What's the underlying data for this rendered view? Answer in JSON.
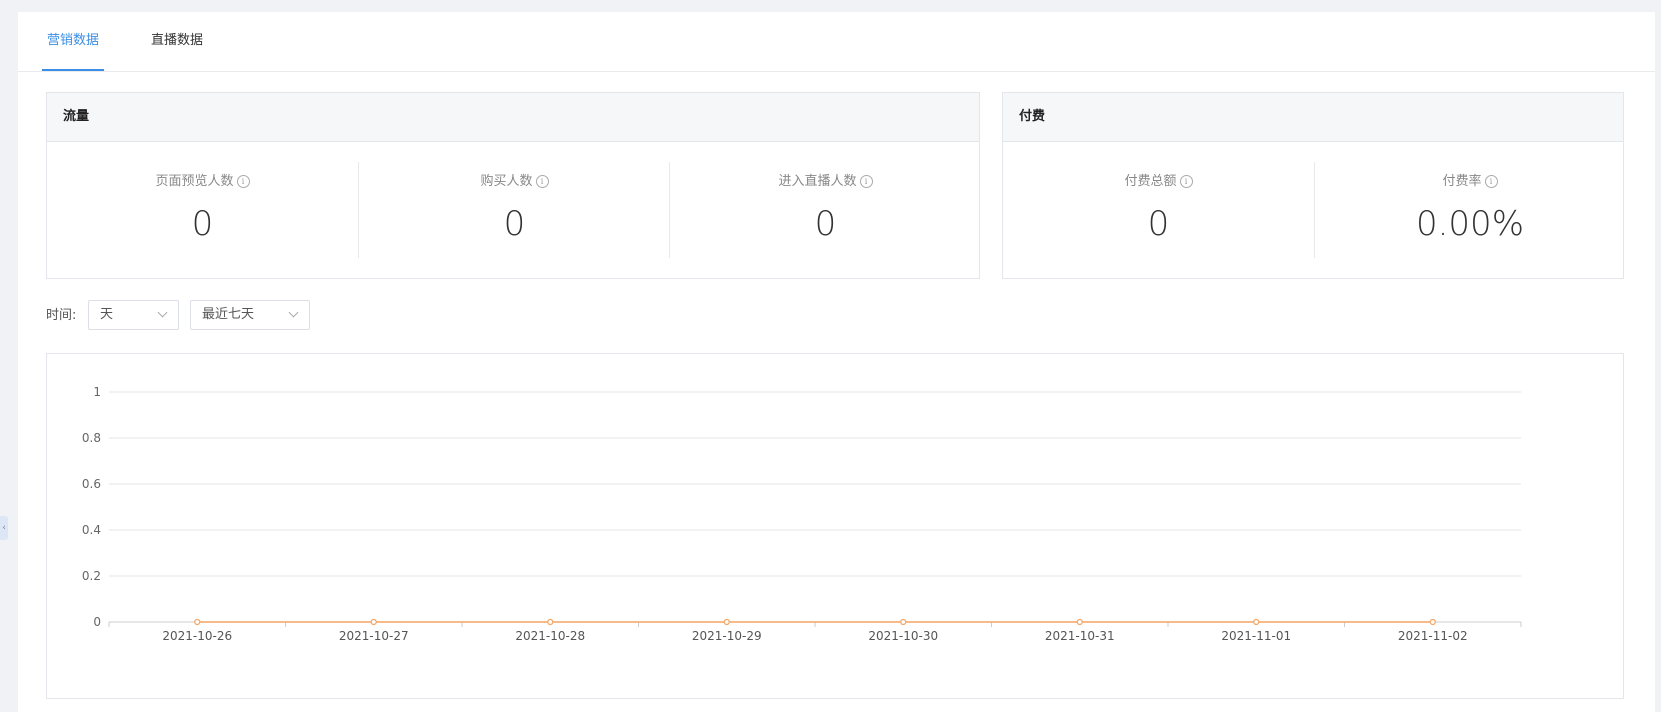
{
  "tabs": [
    {
      "label": "营销数据",
      "active": true
    },
    {
      "label": "直播数据",
      "active": false
    }
  ],
  "traffic_card": {
    "title": "流量",
    "stats": [
      {
        "label": "页面预览人数",
        "value": "0"
      },
      {
        "label": "购买人数",
        "value": "0"
      },
      {
        "label": "进入直播人数",
        "value": "0"
      }
    ]
  },
  "payment_card": {
    "title": "付费",
    "stats": [
      {
        "label": "付费总额",
        "value": "0"
      },
      {
        "label": "付费率",
        "value": "0.00%"
      }
    ]
  },
  "time_filter": {
    "label": "时间:",
    "granularity": "天",
    "range": "最近七天"
  },
  "icons": {
    "info": "info-icon",
    "chevron": "chevron-down-icon",
    "collapse": "chevron-left-icon"
  },
  "colors": {
    "accent": "#3a8ee6",
    "series": "#f5a462",
    "grid": "#e6e6e6"
  },
  "chart_data": {
    "type": "line",
    "x": [
      "2021-10-26",
      "2021-10-27",
      "2021-10-28",
      "2021-10-29",
      "2021-10-30",
      "2021-10-31",
      "2021-11-01",
      "2021-11-02"
    ],
    "series": [
      {
        "values": [
          0,
          0,
          0,
          0,
          0,
          0,
          0,
          0
        ]
      }
    ],
    "yticks": [
      "0",
      "0.2",
      "0.4",
      "0.6",
      "0.8",
      "1"
    ],
    "ylim": [
      0,
      1
    ],
    "grid": true
  }
}
